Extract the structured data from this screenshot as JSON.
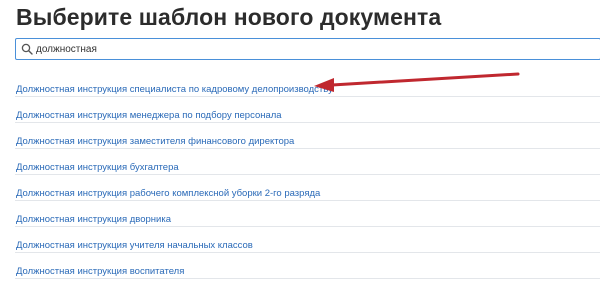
{
  "page": {
    "title": "Выберите шаблон нового документа"
  },
  "search": {
    "value": "должностная",
    "icon": "search-icon"
  },
  "results": [
    "Должностная инструкция специалиста по кадровому делопроизводству",
    "Должностная инструкция менеджера по подбору персонала",
    "Должностная инструкция заместителя финансового директора",
    "Должностная инструкция бухгалтера",
    "Должностная инструкция рабочего комплексной уборки 2-го разряда",
    "Должностная инструкция дворника",
    "Должностная инструкция учителя начальных классов",
    "Должностная инструкция воспитателя"
  ],
  "colors": {
    "link": "#2a6ab8",
    "title": "#2c2c2c",
    "search_border": "#4a90d9",
    "arrow": "#c0282f"
  }
}
